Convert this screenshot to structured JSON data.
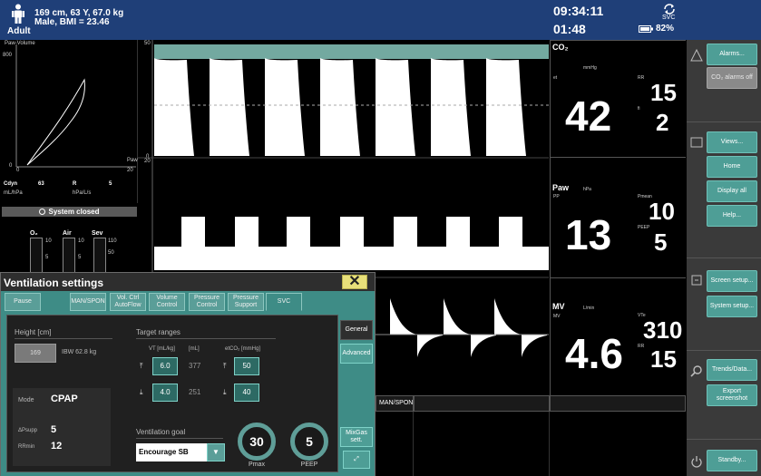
{
  "header": {
    "patient_line1": "169 cm, 63 Y, 67.0 kg",
    "patient_line2": "Male, BMI = 23.46",
    "patient_category": "Adult",
    "clock": "09:34:11",
    "elapsed": "01:48",
    "mode_indicator": "SVC",
    "battery": "82%"
  },
  "sidebar": {
    "alarms": "Alarms...",
    "co2_alarms_off": "CO₂ alarms off",
    "views": "Views...",
    "home": "Home",
    "display_all": "Display all",
    "help": "Help...",
    "screen_setup": "Screen setup...",
    "system_setup": "System setup...",
    "trends": "Trends/Data...",
    "export": "Export screenshot",
    "standby": "Standby..."
  },
  "loop": {
    "title": "Paw-Volume",
    "y_top": "800",
    "y_bottom": "0",
    "x_right": "20",
    "x_label": "Paw",
    "x_zero": "0",
    "cdyn_label": "Cdyn",
    "cdyn_value": "63",
    "r_label": "R",
    "r_value": "5",
    "cdyn_unit": "mL/hPa",
    "r_unit": "hPa/L/s",
    "system_closed": "System closed"
  },
  "gases": {
    "o2": "O₂",
    "air": "Air",
    "sev": "Sev",
    "scale_10": "10",
    "scale_5": "5",
    "scale_0": "0",
    "scale_110": "110",
    "scale_50": "50"
  },
  "waves": {
    "co2_top": "50",
    "co2_bottom": "0",
    "paw_top": "20",
    "flow_zero": "0"
  },
  "params": {
    "co2": {
      "title": "CO₂",
      "unit": "mmHg",
      "sub": "et",
      "value": "42",
      "rr_label": "RR",
      "rr_value": "15",
      "fi_label": "fi",
      "fi_value": "2"
    },
    "paw": {
      "title": "Paw",
      "unit": "hPa",
      "sub": "PP",
      "value": "13",
      "pmean_label": "Pmean",
      "pmean_value": "10",
      "peep_label": "PEEP",
      "peep_value": "5"
    },
    "mv": {
      "title": "MV",
      "unit": "L/min",
      "sub": "MV",
      "value": "4.6",
      "vte_label": "VTe",
      "vte_value": "310",
      "rr_label": "RR",
      "rr_value": "15"
    }
  },
  "bottom_tabs": {
    "tab1": "MAN/SPON"
  },
  "dialog": {
    "title": "Ventilation settings",
    "tabs": [
      "Pause",
      "MAN/SPON",
      "Vol. Ctrl AutoFlow",
      "Volume Control",
      "Pressure Control",
      "Pressure Support",
      "SVC"
    ],
    "height_label": "Height [cm]",
    "height_value": "169",
    "ibw": "IBW 62.8 kg",
    "target_label": "Target ranges",
    "vt_label": "VT [mL/kg]",
    "vt_unit": "[mL]",
    "etco2_label": "etCO₂ [mmHg]",
    "vt_high": "6.0",
    "vt_high_ml": "377",
    "vt_low": "4.0",
    "vt_low_ml": "251",
    "co2_high": "50",
    "co2_low": "40",
    "mode_label": "Mode",
    "mode_value": "CPAP",
    "psupp_label": "ΔPsupp",
    "psupp_value": "5",
    "rrmin_label": "RRmin",
    "rrmin_value": "12",
    "goal_label": "Ventilation goal",
    "goal_value": "Encourage SB",
    "pmax_value": "30",
    "pmax_label": "Pmax",
    "peep_value": "5",
    "peep_label": "PEEP",
    "general": "General",
    "advanced": "Advanced",
    "mixgas": "MixGas sett."
  },
  "colors": {
    "header_bg": "#1f3f78",
    "teal": "#3e8c86",
    "button_teal": "#4e9e96",
    "wave_fill": "#ffffff",
    "co2_band": "#73a9a0"
  }
}
